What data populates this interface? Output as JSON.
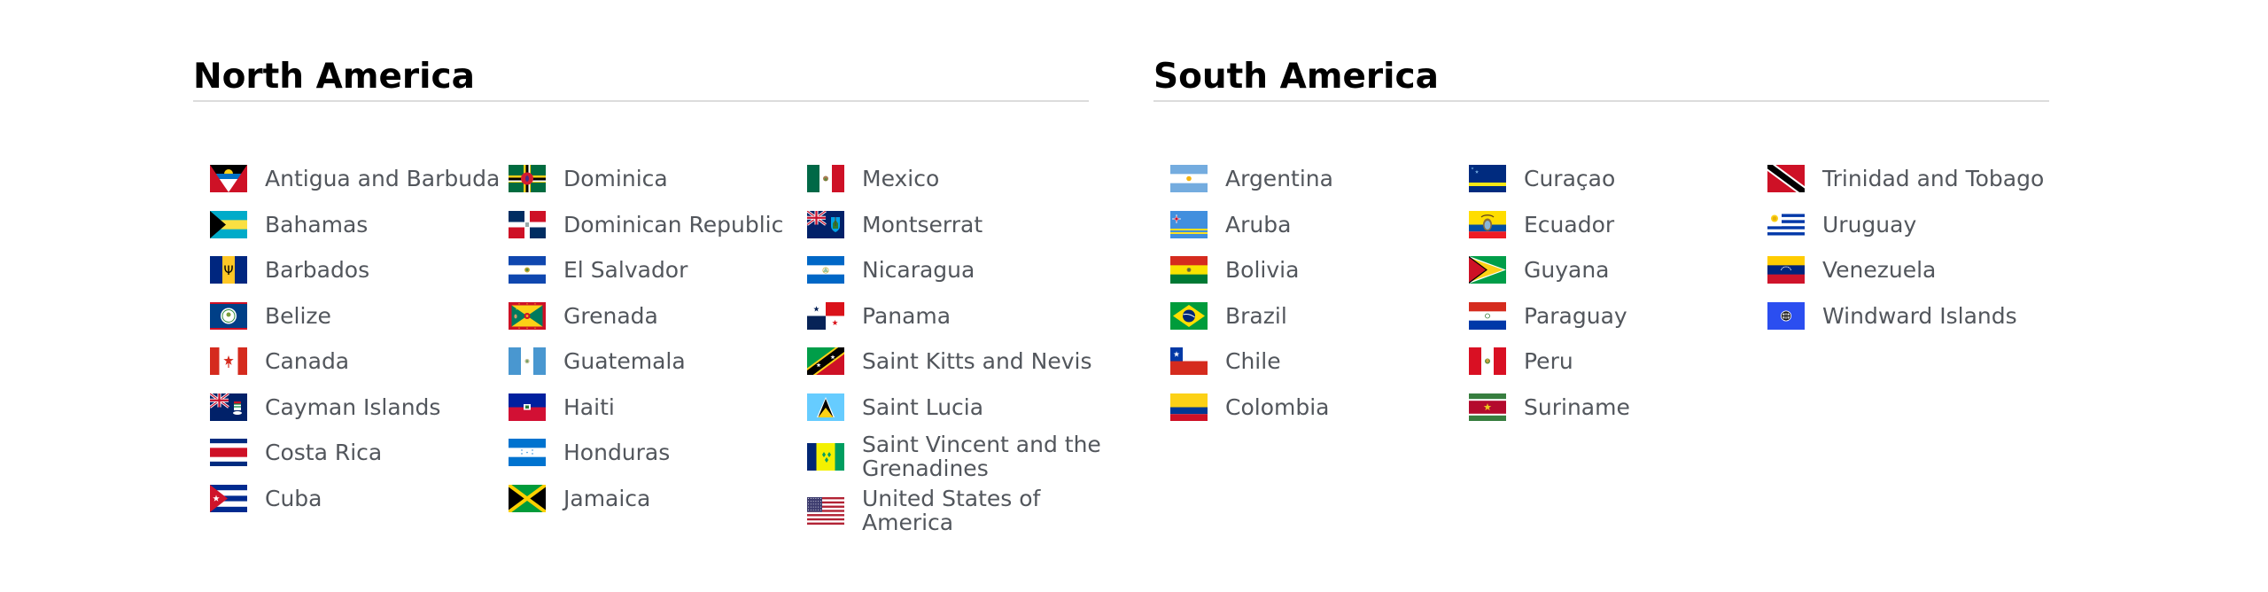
{
  "sections": [
    {
      "title": "North America",
      "columns": [
        [
          {
            "name": "Antigua and Barbuda",
            "flag": "flag-antigua-and-barbuda-icon"
          },
          {
            "name": "Bahamas",
            "flag": "flag-bahamas-icon"
          },
          {
            "name": "Barbados",
            "flag": "flag-barbados-icon"
          },
          {
            "name": "Belize",
            "flag": "flag-belize-icon"
          },
          {
            "name": "Canada",
            "flag": "flag-canada-icon"
          },
          {
            "name": "Cayman Islands",
            "flag": "flag-cayman-islands-icon"
          },
          {
            "name": "Costa Rica",
            "flag": "flag-costa-rica-icon"
          },
          {
            "name": "Cuba",
            "flag": "flag-cuba-icon"
          }
        ],
        [
          {
            "name": "Dominica",
            "flag": "flag-dominica-icon"
          },
          {
            "name": "Dominican Republic",
            "flag": "flag-dominican-republic-icon"
          },
          {
            "name": "El Salvador",
            "flag": "flag-el-salvador-icon"
          },
          {
            "name": "Grenada",
            "flag": "flag-grenada-icon"
          },
          {
            "name": "Guatemala",
            "flag": "flag-guatemala-icon"
          },
          {
            "name": "Haiti",
            "flag": "flag-haiti-icon"
          },
          {
            "name": "Honduras",
            "flag": "flag-honduras-icon"
          },
          {
            "name": "Jamaica",
            "flag": "flag-jamaica-icon"
          }
        ],
        [
          {
            "name": "Mexico",
            "flag": "flag-mexico-icon"
          },
          {
            "name": "Montserrat",
            "flag": "flag-montserrat-icon"
          },
          {
            "name": "Nicaragua",
            "flag": "flag-nicaragua-icon"
          },
          {
            "name": "Panama",
            "flag": "flag-panama-icon"
          },
          {
            "name": "Saint Kitts and Nevis",
            "flag": "flag-saint-kitts-and-nevis-icon"
          },
          {
            "name": "Saint Lucia",
            "flag": "flag-saint-lucia-icon"
          },
          {
            "name": "Saint Vincent and the Grenadines",
            "flag": "flag-saint-vincent-icon"
          },
          {
            "name": "United States of America",
            "flag": "flag-usa-icon"
          }
        ]
      ]
    },
    {
      "title": "South America",
      "columns": [
        [
          {
            "name": "Argentina",
            "flag": "flag-argentina-icon"
          },
          {
            "name": "Aruba",
            "flag": "flag-aruba-icon"
          },
          {
            "name": "Bolivia",
            "flag": "flag-bolivia-icon"
          },
          {
            "name": "Brazil",
            "flag": "flag-brazil-icon"
          },
          {
            "name": "Chile",
            "flag": "flag-chile-icon"
          },
          {
            "name": "Colombia",
            "flag": "flag-colombia-icon"
          }
        ],
        [
          {
            "name": "Curaçao",
            "flag": "flag-curacao-icon"
          },
          {
            "name": "Ecuador",
            "flag": "flag-ecuador-icon"
          },
          {
            "name": "Guyana",
            "flag": "flag-guyana-icon"
          },
          {
            "name": "Paraguay",
            "flag": "flag-paraguay-icon"
          },
          {
            "name": "Peru",
            "flag": "flag-peru-icon"
          },
          {
            "name": "Suriname",
            "flag": "flag-suriname-icon"
          }
        ],
        [
          {
            "name": "Trinidad and Tobago",
            "flag": "flag-trinidad-and-tobago-icon"
          },
          {
            "name": "Uruguay",
            "flag": "flag-uruguay-icon"
          },
          {
            "name": "Venezuela",
            "flag": "flag-venezuela-icon"
          },
          {
            "name": "Windward Islands",
            "flag": "flag-windward-islands-icon"
          }
        ]
      ]
    }
  ]
}
